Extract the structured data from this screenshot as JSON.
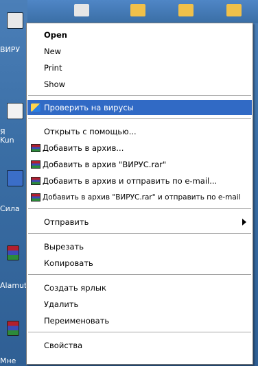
{
  "desktop": {
    "icon_labels": [
      "ВИРУ",
      "Я",
      "Kun",
      "Сила",
      "Alamut",
      "Мне"
    ]
  },
  "menu": {
    "items": [
      {
        "label": "Open"
      },
      {
        "label": "New"
      },
      {
        "label": "Print"
      },
      {
        "label": "Show"
      },
      {
        "label": "Проверить на вирусы"
      },
      {
        "label": "Открыть с помощью..."
      },
      {
        "label": "Добавить в архив..."
      },
      {
        "label": "Добавить в архив \"ВИРУС.rar\""
      },
      {
        "label": "Добавить в архив и отправить по e-mail..."
      },
      {
        "label": "Добавить в архив \"ВИРУС.rar\" и отправить по e-mail"
      },
      {
        "label": "Отправить"
      },
      {
        "label": "Вырезать"
      },
      {
        "label": "Копировать"
      },
      {
        "label": "Создать ярлык"
      },
      {
        "label": "Удалить"
      },
      {
        "label": "Переименовать"
      },
      {
        "label": "Свойства"
      }
    ],
    "highlight_color": "#316ac5",
    "separator_color": "#a5a5a5"
  }
}
